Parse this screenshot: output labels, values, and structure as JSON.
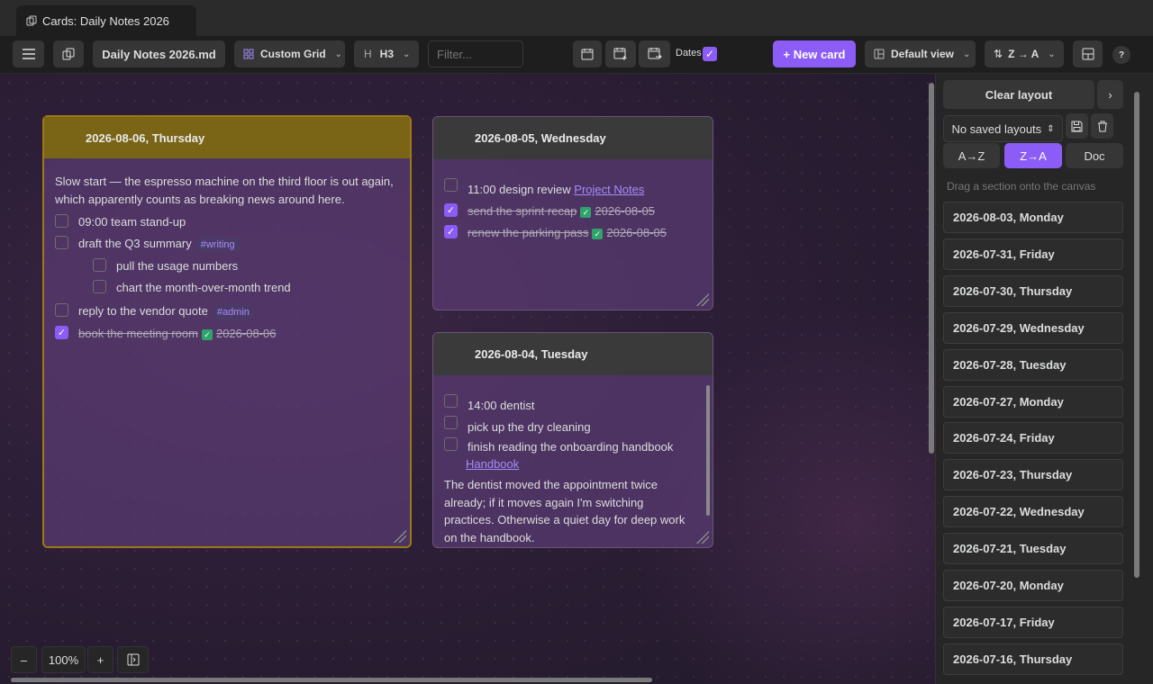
{
  "tab": {
    "title": "Cards: Daily Notes 2026"
  },
  "toolbar": {
    "file": "Daily Notes 2026.md",
    "layout": "Custom Grid",
    "heading": "H3",
    "filter_placeholder": "Filter...",
    "dates_label": "Dates",
    "dates_checked": true,
    "new_card": "+ New card",
    "view": "Default view",
    "sort": "Z → A",
    "help": "?"
  },
  "cards": [
    {
      "title": "2026-08-06, Thursday",
      "color": "#7a6415",
      "intro": "Slow start — the espresso machine on the third floor is out again, which apparently counts as breaking news around here.",
      "items": [
        {
          "text": "09:00 team stand-up",
          "done": false
        },
        {
          "text": "draft the Q3 summary",
          "tag": "#writing",
          "done": false
        },
        {
          "text": "pull the usage numbers",
          "done": false,
          "sub": true
        },
        {
          "text": "chart the month-over-month trend",
          "done": false,
          "sub": true
        },
        {
          "text": "reply to the vendor quote",
          "tag": "#admin",
          "done": false
        },
        {
          "text": "book the meeting room",
          "done": true,
          "date": "2026-08-06"
        }
      ]
    },
    {
      "title": "2026-08-05, Wednesday",
      "items": [
        {
          "text": "11:00 design review",
          "link": "Project Notes",
          "done": false
        },
        {
          "text": "send the sprint recap",
          "done": true,
          "date": "2026-08-05"
        },
        {
          "text": "renew the parking pass",
          "done": true,
          "date": "2026-08-05"
        }
      ]
    },
    {
      "title": "2026-08-04, Tuesday",
      "items": [
        {
          "text": "14:00 dentist",
          "done": false
        },
        {
          "text": "pick up the dry cleaning",
          "done": false
        },
        {
          "text": "finish reading the onboarding handbook",
          "link": "Handbook",
          "done": false
        }
      ],
      "outro": "The dentist moved the appointment twice already; if it moves again I'm switching practices. Otherwise a quiet day for deep work on the handbook."
    }
  ],
  "zoom": {
    "minus": "–",
    "level": "100%",
    "plus": "+"
  },
  "sidebar": {
    "clear_layout": "Clear layout",
    "saved_layouts": "No saved layouts",
    "sort_az": "A→Z",
    "sort_za": "Z→A",
    "doc": "Doc",
    "hint": "Drag a section onto the canvas",
    "sections": [
      "2026-08-03, Monday",
      "2026-07-31, Friday",
      "2026-07-30, Thursday",
      "2026-07-29, Wednesday",
      "2026-07-28, Tuesday",
      "2026-07-27, Monday",
      "2026-07-24, Friday",
      "2026-07-23, Thursday",
      "2026-07-22, Wednesday",
      "2026-07-21, Tuesday",
      "2026-07-20, Monday",
      "2026-07-17, Friday",
      "2026-07-16, Thursday"
    ]
  },
  "colors": {
    "accent": "#8b5cf6",
    "card_yellow": "#7a6415",
    "tag": "#a78bfa",
    "done_check": "#2ea36a"
  }
}
